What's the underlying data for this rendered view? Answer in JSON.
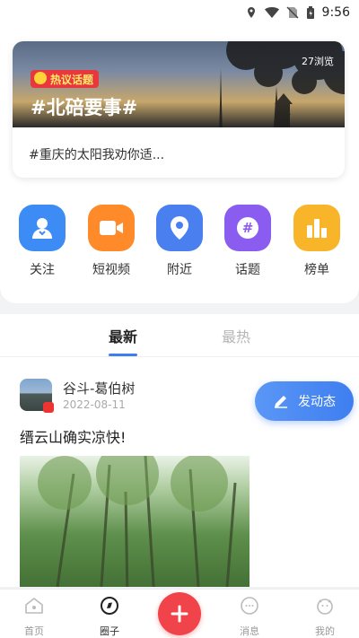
{
  "status_bar": {
    "time": "9:56",
    "icons": [
      "location-icon",
      "wifi-icon",
      "no-sim-icon",
      "battery-icon"
    ]
  },
  "hot_topic": {
    "tag": "热议话题",
    "title": "#北碚要事#",
    "views": "27浏览",
    "description": "#重庆的太阳我劝你适..."
  },
  "shortcuts": [
    {
      "label": "关注",
      "icon": "follow-icon",
      "color": "#3d8bf5"
    },
    {
      "label": "短视频",
      "icon": "video-icon",
      "color": "#ff8a2a"
    },
    {
      "label": "附近",
      "icon": "location-pin-icon",
      "color": "#4a7ff0"
    },
    {
      "label": "话题",
      "icon": "hashtag-icon",
      "color": "#8a5cf0"
    },
    {
      "label": "榜单",
      "icon": "chart-icon",
      "color": "#f8b52a"
    }
  ],
  "feed_tabs": [
    {
      "label": "最新",
      "active": true
    },
    {
      "label": "最热",
      "active": false
    }
  ],
  "post": {
    "username": "谷斗-葛伯树",
    "date": "2022-08-11",
    "text": "缙云山确实凉快!"
  },
  "publish_button": {
    "label": "发动态"
  },
  "tabbar": [
    {
      "label": "首页",
      "icon": "home-icon",
      "active": false
    },
    {
      "label": "圈子",
      "icon": "circle-icon",
      "active": true
    },
    {
      "label": "消息",
      "icon": "message-icon",
      "active": false
    },
    {
      "label": "我的",
      "icon": "profile-icon",
      "active": false
    }
  ],
  "colors": {
    "accent": "#3e7ef0",
    "add_button": "#f0444a",
    "hot_tag": "#e8383d"
  }
}
